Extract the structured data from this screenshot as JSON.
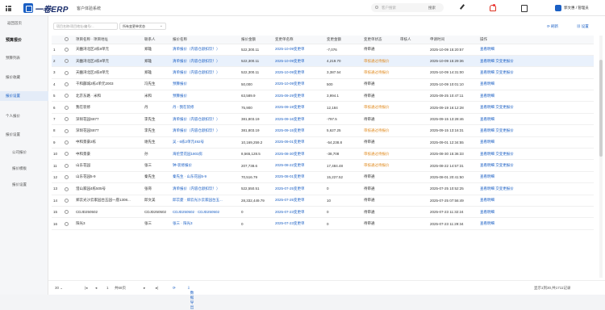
{
  "header": {
    "logo": "一卷ERP",
    "system_name": "客户体验系统",
    "search_placeholder": "客户搜索",
    "search_button": "搜索",
    "user_name": "郭文惠 / 管理员"
  },
  "sidebar": {
    "back_label": "返回首页",
    "group_quote": "预算报价",
    "items": [
      "预算列表",
      "报价收藏",
      "报价设置",
      "个人报价"
    ],
    "group_settings": "报价设置",
    "sub_items": [
      "公司报价",
      "报价模板",
      "报价设置"
    ]
  },
  "toolbar": {
    "search_placeholder": "项目名称/项目地址/编号/...",
    "filter_value": "所有变更单状态",
    "refresh_label": "刷新",
    "settings_label": "设置"
  },
  "table": {
    "columns": [
      "",
      "",
      "项目名称 · 项目地址",
      "联系人",
      "报价名称",
      "报价金额",
      "变更单名称",
      "变更金额",
      "变更单状态",
      "审核人",
      "申请时间",
      "操作"
    ],
    "rows": [
      {
        "no": "1",
        "project": "天豳湾北区2栋8单元",
        "contact": "郑雄",
        "quote": "清单报价（内容仓颜扣饮！）",
        "amount": "522,300.11",
        "change": "2025-10-09变更单",
        "change_amount": "-7,076",
        "status": "待审通",
        "reviewer": "",
        "time": "2025-10-09 15:20:57",
        "ops": "查看明细"
      },
      {
        "no": "2",
        "project": "天豳湾北区2栋8单元",
        "contact": "郑雄",
        "quote": "清单报价（内容仓颜扣饮！）",
        "amount": "522,300.11",
        "change": "2025-10-09变更单",
        "change_amount": "4,219.70",
        "status": "审核通过待报价",
        "reviewer": "",
        "time": "2025-10-09 15:29:36",
        "ops": "查看明细 交变更报价"
      },
      {
        "no": "3",
        "project": "天豳湾北区2栋8单元",
        "contact": "郑雄",
        "quote": "清单报价（内容仓颜扣饮！）",
        "amount": "522,300.11",
        "change": "2025-10-09变更单",
        "change_amount": "3,387.54",
        "status": "审核通过待报价",
        "reviewer": "",
        "time": "2025-10-09 14:31:00",
        "ops": "查看明细 交变更报价"
      },
      {
        "no": "4",
        "project": "千和酃城2栋4单元2003",
        "contact": "冯先生",
        "quote": "预算报价",
        "amount": "50,000",
        "change": "2025-10-09变更单",
        "change_amount": "500",
        "status": "待审通",
        "reviewer": "",
        "time": "2025-10-09 10:01:10",
        "ops": "查看明细"
      },
      {
        "no": "5",
        "project": "北京东路 · 米和",
        "contact": "米和",
        "quote": "预算报价",
        "amount": "63,589.9",
        "change": "2025-09-29变更单",
        "change_amount": "3,994.1",
        "status": "待审通",
        "reviewer": "",
        "time": "2025-09-25 10:47:11",
        "ops": "查看明细"
      },
      {
        "no": "6",
        "project": "我在装修",
        "contact": "丹",
        "quote": "丹 - 我在装修",
        "amount": "75,900",
        "change": "2025-09-19变更单",
        "change_amount": "12,184",
        "status": "审核通过待报价",
        "reviewer": "",
        "time": "2025-09-19 16:12:28",
        "ops": "查看明细 交变更报价"
      },
      {
        "no": "7",
        "project": "深圳花园S877",
        "contact": "李先生",
        "quote": "清单报价（内容仓颜扣饮！）",
        "amount": "381,803.19",
        "change": "2025-09-16变更单",
        "change_amount": "-797.5",
        "status": "待审通",
        "reviewer": "",
        "time": "2025-09-15 13:28:46",
        "ops": "查看明细"
      },
      {
        "no": "8",
        "project": "深圳花园S877",
        "contact": "李先生",
        "quote": "清单报价（内容仓颜扣饮！）",
        "amount": "381,803.19",
        "change": "2025-09-15变更单",
        "change_amount": "5,627.25",
        "status": "审核通过待报价",
        "reviewer": "",
        "time": "2025-09-15 13:16:31",
        "ops": "查看明细 交变更报价"
      },
      {
        "no": "9",
        "project": "中和景豪2栋",
        "contact": "谢先生",
        "quote": "吴 - 6栋2单元492号",
        "amount": "10,169,259.2",
        "change": "2025-09-01变更单",
        "change_amount": "-54,238.8",
        "status": "待审通",
        "reviewer": "",
        "time": "2025-09-01 12:34:55",
        "ops": "查看明细"
      },
      {
        "no": "10",
        "project": "中和景豪",
        "contact": "孙",
        "quote": "海伦堡花园1803房",
        "amount": "8,565,128.5",
        "change": "2025-08-30变更单",
        "change_amount": "-38,708",
        "status": "审核通过待报价",
        "reviewer": "",
        "time": "2025-08-30 15:36:33",
        "ops": "查看明细 交变更报价"
      },
      {
        "no": "11",
        "project": "山东花园",
        "contact": "张三",
        "quote": "钟-装修报价",
        "amount": "207,738.6",
        "change": "2025-08-22变更单",
        "change_amount": "17,484.48",
        "status": "审核通过待报价",
        "reviewer": "",
        "time": "2025-08-22 14:57:31",
        "ops": "查看明细 交变更报价"
      },
      {
        "no": "12",
        "project": "山东花园5-9",
        "contact": "秦先生",
        "quote": "秦先生 · 山东花园5-9",
        "amount": "70,516.79",
        "change": "2025-08-01变更单",
        "change_amount": "15,227.52",
        "status": "待审通",
        "reviewer": "",
        "time": "2025-08-01 20:41:50",
        "ops": "查看明细"
      },
      {
        "no": "13",
        "project": "澄山家园4栋505号",
        "contact": "张哥",
        "quote": "清单报价（内容仓颜扣饮！）",
        "amount": "522,550.51",
        "change": "2025-07-25变更单",
        "change_amount": "0",
        "status": "待审通",
        "reviewer": "",
        "time": "2025-07-25 10:52:25",
        "ops": "查看明细 交变更报价"
      },
      {
        "no": "14",
        "project": "郑云光沙云家园台五园一座1308...",
        "contact": "邱文美",
        "quote": "邱苡菱 · 郑云光沙云家园台五...",
        "amount": "28,332,449.79",
        "change": "2025-07-25变更单",
        "change_amount": "10",
        "status": "待审通",
        "reviewer": "",
        "time": "2025-07-25 07:56:49",
        "ops": "查看明细"
      },
      {
        "no": "15",
        "project": "CDJD250502",
        "contact": "CDJD250502",
        "quote": "CDJD250502 · CDJD250502",
        "amount": "0",
        "change": "2025-07-23变更单",
        "change_amount": "0",
        "status": "待审通",
        "reviewer": "",
        "time": "2025-07-23 11:32:24",
        "ops": "查看明细"
      },
      {
        "no": "16",
        "project": "阳光3",
        "contact": "张三",
        "quote": "张三 · 阳光3",
        "amount": "0",
        "change": "2025-07-23变更单",
        "change_amount": "0",
        "status": "待审通",
        "reviewer": "",
        "time": "2025-07-23 11:29:34",
        "ops": "查看明细"
      }
    ]
  },
  "pager": {
    "page_size": "30",
    "page": "1",
    "total_pages": "共68页",
    "export_label": "数据导出",
    "summary": "显示1到30,共1711记录"
  }
}
